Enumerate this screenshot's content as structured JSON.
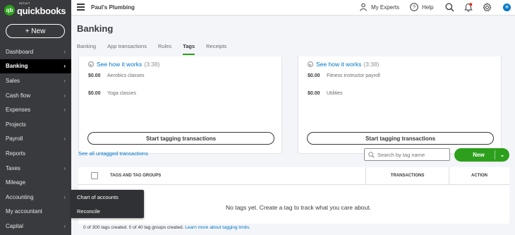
{
  "brand": {
    "small": "INTUIT",
    "name": "quickbooks",
    "mark": "qb"
  },
  "sidebar": {
    "new_label": "+  New",
    "items": [
      {
        "label": "Dashboard",
        "chevron": true
      },
      {
        "label": "Banking",
        "chevron": true,
        "active": true
      },
      {
        "label": "Sales",
        "chevron": true
      },
      {
        "label": "Cash flow",
        "chevron": true
      },
      {
        "label": "Expenses",
        "chevron": true
      },
      {
        "label": "Projects",
        "chevron": false
      },
      {
        "label": "Payroll",
        "chevron": true
      },
      {
        "label": "Reports",
        "chevron": false
      },
      {
        "label": "Taxes",
        "chevron": true
      },
      {
        "label": "Mileage",
        "chevron": false
      },
      {
        "label": "Accounting",
        "chevron": true
      },
      {
        "label": "My accountant",
        "chevron": false
      },
      {
        "label": "Capital",
        "chevron": true
      }
    ],
    "chevron_char": "›"
  },
  "flyout": {
    "items": [
      "Chart of accounts",
      "Reconcile"
    ]
  },
  "topbar": {
    "company": "Paul's Plumbing",
    "experts": "My Experts",
    "help": "Help",
    "avatar": "H"
  },
  "page": {
    "title": "Banking",
    "tabs": [
      "Banking",
      "App transactions",
      "Rules",
      "Tags",
      "Receipts"
    ],
    "active_tab": "Tags"
  },
  "cards": [
    {
      "see_how": "See how it works",
      "duration": "(3:38)",
      "tags": [
        {
          "amount": "$0.00",
          "name": "Aerobics classes"
        },
        {
          "amount": "$0.00",
          "name": "Yoga classes"
        }
      ],
      "button": "Start tagging transactions"
    },
    {
      "see_how": "See how it works",
      "duration": "(3:38)",
      "tags": [
        {
          "amount": "$0.00",
          "name": "Fitness instructor payroll"
        },
        {
          "amount": "$0.00",
          "name": "Utilities"
        }
      ],
      "button": "Start tagging transactions"
    }
  ],
  "untagged_link": "See all untagged transactions",
  "search": {
    "placeholder": "Search by tag name"
  },
  "new_button": "New",
  "table": {
    "columns": [
      "TAGS AND TAG GROUPS",
      "TRANSACTIONS",
      "ACTION"
    ],
    "empty_message": "No tags yet. Create a tag to track what you care about."
  },
  "footer": {
    "text": "0 of 300 tags created. 0 of 40 tag groups created.",
    "link": "Learn more about tagging limits."
  },
  "colors": {
    "accent": "#2ca01c",
    "link": "#0077c5",
    "sidebar": "#393a3d",
    "notification": "#d52b1e"
  }
}
